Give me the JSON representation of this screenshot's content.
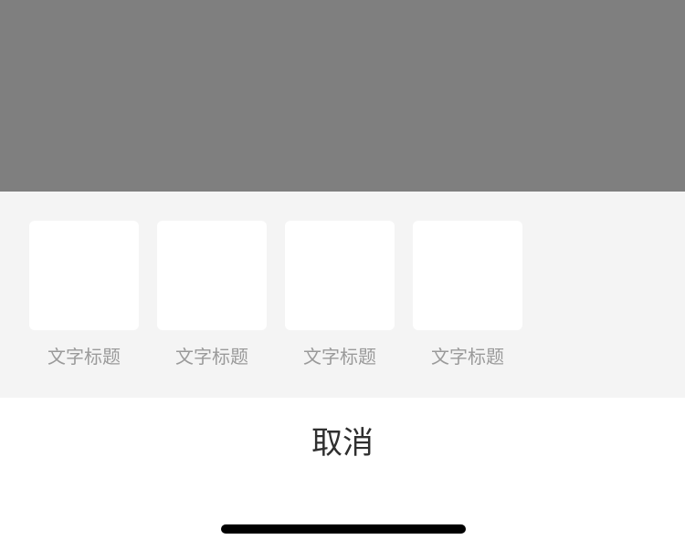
{
  "share_sheet": {
    "items": [
      {
        "label": "文字标题"
      },
      {
        "label": "文字标题"
      },
      {
        "label": "文字标题"
      },
      {
        "label": "文字标题"
      }
    ],
    "cancel_label": "取消"
  },
  "colors": {
    "overlay": "#7f7f7f",
    "panel_background": "#f4f4f4",
    "tile": "#ffffff",
    "label": "#9a9a9a",
    "cancel_text": "#2f2f2f"
  }
}
